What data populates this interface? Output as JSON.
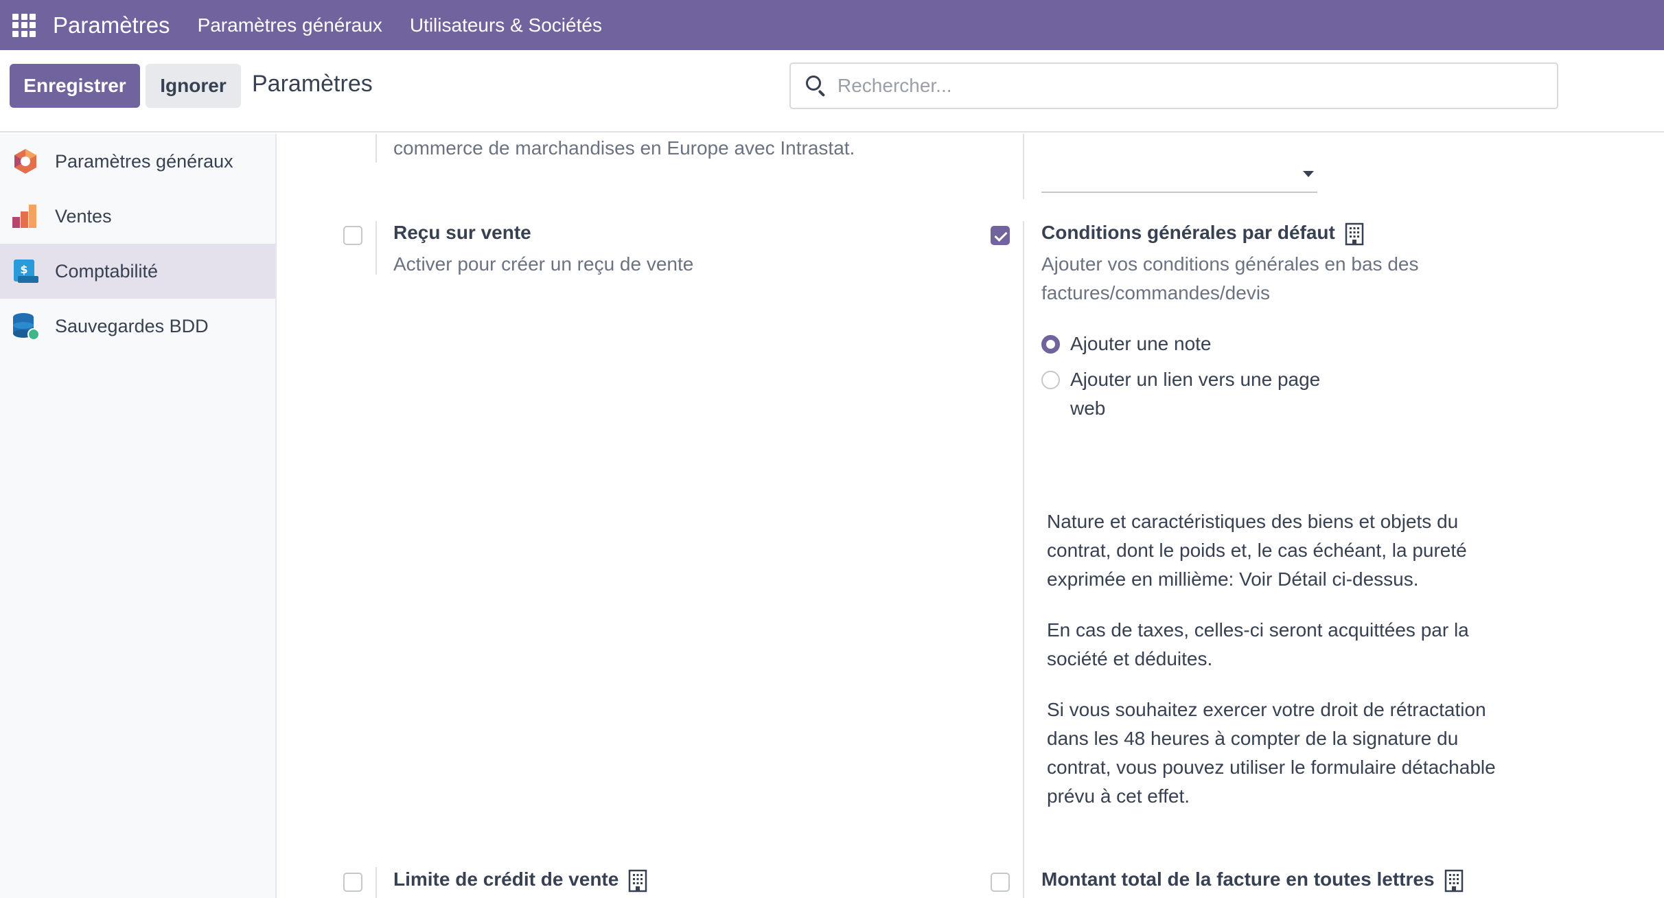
{
  "navbar": {
    "app_name": "Paramètres",
    "menu": [
      "Paramètres généraux",
      "Utilisateurs & Sociétés"
    ]
  },
  "control": {
    "save_label": "Enregistrer",
    "ignore_label": "Ignorer",
    "title": "Paramètres",
    "search_placeholder": "Rechercher..."
  },
  "sidebar": {
    "items": [
      {
        "label": "Paramètres généraux",
        "icon": "settings-logo-icon",
        "active": false
      },
      {
        "label": "Ventes",
        "icon": "sales-chart-icon",
        "active": false
      },
      {
        "label": "Comptabilité",
        "icon": "accounting-icon",
        "active": true
      },
      {
        "label": "Sauvegardes BDD",
        "icon": "database-backup-icon",
        "active": false
      }
    ]
  },
  "settings": {
    "intrastat_desc_tail": "commerce de marchandises en Europe avec Intrastat.",
    "sale_receipt": {
      "title": "Reçu sur vente",
      "desc": "Activer pour créer un reçu de vente",
      "checked": false
    },
    "default_terms": {
      "title": "Conditions générales par défaut",
      "desc": "Ajouter vos conditions générales en bas des factures/commandes/devis",
      "checked": true,
      "options": [
        "Ajouter une note",
        "Ajouter un lien vers une page web"
      ],
      "selected": 0,
      "note": [
        "Nature et caractéristiques des biens et objets du contrat, dont le poids et, le cas échéant, la pureté exprimée en millième: Voir Détail ci-dessus.",
        "En cas de taxes, celles-ci seront acquittées par la société et déduites.",
        "Si vous souhaitez exercer votre droit de rétractation dans les 48 heures à compter de la signature du contrat, vous pouvez utiliser le formulaire détachable prévu à cet effet."
      ]
    },
    "sale_credit_limit": {
      "title": "Limite de crédit de vente",
      "checked": false
    },
    "amount_in_words": {
      "title": "Montant total de la facture en toutes lettres",
      "checked": false
    }
  },
  "colors": {
    "brand": "#71639e",
    "sidebar_active": "#e4e1ec"
  }
}
